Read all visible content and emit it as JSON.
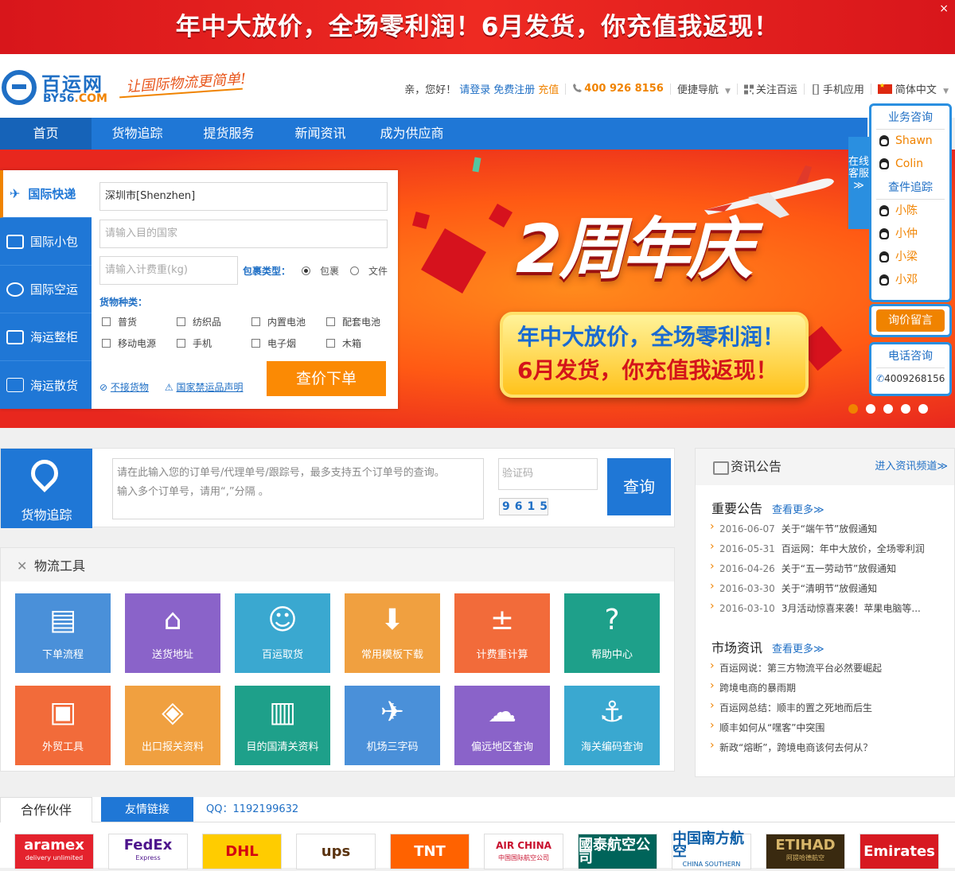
{
  "top_banner": {
    "text": "年中大放价，全场零利润！6月发货，你充值我返现！",
    "close": "×"
  },
  "header": {
    "logo_cn": "百运网",
    "logo_en": "BY56",
    "logo_en_suffix": ".COM",
    "slogan": "让国际物流更简单!",
    "greeting": "亲，您好！",
    "login": "请登录",
    "register": "免费注册",
    "recharge": "充值",
    "phone": "400 926 8156",
    "quick_nav": "便捷导航",
    "follow": "关注百运",
    "mobile_app": "手机应用",
    "language": "简体中文"
  },
  "nav": {
    "items": [
      "首页",
      "货物追踪",
      "提货服务",
      "新闻资讯",
      "成为供应商"
    ]
  },
  "hero": {
    "title": "2周年庆",
    "line1": "年中大放价，全场零利润！",
    "line2": "6月发货，你充值我返现！"
  },
  "quote_form": {
    "tabs": [
      "国际快递",
      "国际小包",
      "国际空运",
      "海运整柜",
      "海运散货"
    ],
    "origin_value": "深圳市[Shenzhen]",
    "dest_placeholder": "请输入目的国家",
    "weight_placeholder": "请输入计费重(kg)",
    "package_type_label": "包裹类型：",
    "package_types": [
      "包裹",
      "文件"
    ],
    "goods_label": "货物种类：",
    "goods": [
      "普货",
      "纺织品",
      "内置电池",
      "配套电池",
      "移动电源",
      "手机",
      "电子烟",
      "木箱"
    ],
    "link_rejected": "不接货物",
    "link_prohibited": "国家禁运品声明",
    "submit": "查价下单"
  },
  "side_panel": {
    "business_title": "业务咨询",
    "business_agents": [
      "Shawn",
      "Colin"
    ],
    "tracking_title": "查件追踪",
    "tracking_agents": [
      "小陈",
      "小仲",
      "小梁",
      "小邓"
    ],
    "message_button": "询价留言",
    "phone_title": "电话咨询",
    "phone_number": "4009268156",
    "tab_label": "在线客服≫"
  },
  "tracking": {
    "label": "货物追踪",
    "placeholder_line1": "请在此输入您的订单号/代理单号/跟踪号，最多支持五个订单号的查询。",
    "placeholder_line2": "输入多个订单号，请用“,”分隔 。",
    "captcha_placeholder": "验证码",
    "captcha_code": "9615",
    "button": "查询"
  },
  "news": {
    "title": "资讯公告",
    "more_channel": "进入资讯频道≫",
    "notice_title": "重要公告",
    "notice_more": "查看更多≫",
    "notices": [
      {
        "date": "2016-06-07",
        "text": "关于“端午节”放假通知"
      },
      {
        "date": "2016-05-31",
        "text": "百运网：年中大放价，全场零利润"
      },
      {
        "date": "2016-04-26",
        "text": "关于“五一劳动节”放假通知"
      },
      {
        "date": "2016-03-30",
        "text": "关于“清明节”放假通知"
      },
      {
        "date": "2016-03-10",
        "text": "3月活动惊喜来袭！苹果电脑等..."
      }
    ],
    "market_title": "市场资讯",
    "market_more": "查看更多≫",
    "market": [
      "百运网说：第三方物流平台必然要崛起",
      "跨境电商的暴雨期",
      "百运网总结：顺丰的置之死地而后生",
      "顺丰如何从“嘿客”中突围",
      "新政“熔断”，跨境电商该何去何从？"
    ]
  },
  "tools": {
    "title": "物流工具",
    "items": [
      {
        "label": "下单流程",
        "icon": "document-icon",
        "color": "#4a90d9"
      },
      {
        "label": "送货地址",
        "icon": "home-icon",
        "color": "#8a63c9"
      },
      {
        "label": "百运取货",
        "icon": "courier-icon",
        "color": "#3aa8d0"
      },
      {
        "label": "常用模板下载",
        "icon": "download-icon",
        "color": "#f0a040"
      },
      {
        "label": "计费重计算",
        "icon": "calculator-icon",
        "color": "#f26b3a"
      },
      {
        "label": "帮助中心",
        "icon": "help-icon",
        "color": "#1ea08a"
      },
      {
        "label": "外贸工具",
        "icon": "toolbox-icon",
        "color": "#f26b3a"
      },
      {
        "label": "出口报关资料",
        "icon": "box-icon",
        "color": "#f0a040"
      },
      {
        "label": "目的国清关资料",
        "icon": "file-icon",
        "color": "#1ea08a"
      },
      {
        "label": "机场三字码",
        "icon": "airplane-icon",
        "color": "#4a90d9"
      },
      {
        "label": "偏远地区查询",
        "icon": "cloud-icon",
        "color": "#8a63c9"
      },
      {
        "label": "海关编码查询",
        "icon": "anchor-icon",
        "color": "#3aa8d0"
      }
    ]
  },
  "partners": {
    "tab_partners": "合作伙伴",
    "tab_links": "友情链接",
    "qq": "QQ：1192199632",
    "logos": [
      {
        "text": "aramex",
        "sub": "delivery unlimited"
      },
      {
        "text": "FedEx",
        "sub": "Express"
      },
      {
        "text": "DHL",
        "sub": ""
      },
      {
        "text": "ups",
        "sub": ""
      },
      {
        "text": "TNT",
        "sub": ""
      },
      {
        "text": "AIR CHINA",
        "sub": "中国国际航空公司"
      },
      {
        "text": "國泰航空公司",
        "sub": ""
      },
      {
        "text": "中国南方航空",
        "sub": "CHINA SOUTHERN"
      },
      {
        "text": "ETIHAD",
        "sub": "阿提哈德航空"
      },
      {
        "text": "Emirates",
        "sub": ""
      }
    ]
  }
}
